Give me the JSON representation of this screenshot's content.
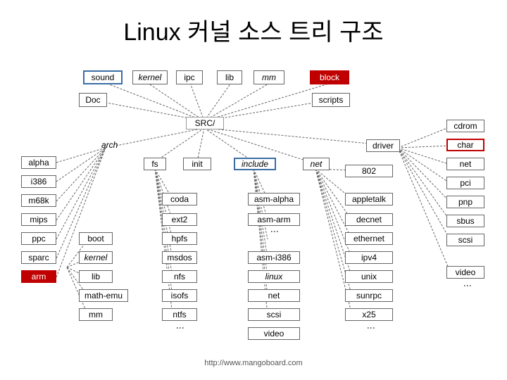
{
  "title": "Linux 커널 소스 트리 구조",
  "row1": {
    "sound": "sound",
    "kernel": "kernel",
    "ipc": "ipc",
    "lib": "lib",
    "mm": "mm",
    "block": "block"
  },
  "doc": "Doc",
  "scripts": "scripts",
  "src": "SRC/",
  "arch": "arch",
  "driver": "driver",
  "archlist": {
    "alpha": "alpha",
    "i386": "i386",
    "m68k": "m68k",
    "mips": "mips",
    "ppc": "ppc",
    "sparc": "sparc",
    "arm": "arm"
  },
  "sub": {
    "boot": "boot",
    "kernel": "kernel",
    "lib": "lib",
    "mathemu": "math-emu",
    "mm": "mm"
  },
  "fs": "fs",
  "init": "init",
  "fslist": {
    "coda": "coda",
    "ext2": "ext2",
    "hpfs": "hpfs",
    "msdos": "msdos",
    "nfs": "nfs",
    "isofs": "isofs",
    "ntfs": "ntfs"
  },
  "include": "include",
  "inclist": {
    "asmalpha": "asm-alpha",
    "asmarm": "asm-arm",
    "asmi386": "asm-i386",
    "linux": "linux",
    "net": "net",
    "scsi": "scsi",
    "video": "video"
  },
  "netlabel": "net",
  "netlist": {
    "n802": "802",
    "appletalk": "appletalk",
    "decnet": "decnet",
    "ethernet": "ethernet",
    "ipv4": "ipv4",
    "unix": "unix",
    "sunrpc": "sunrpc",
    "x25": "x25"
  },
  "right": {
    "cdrom": "cdrom",
    "char": "char",
    "net": "net",
    "pci": "pci",
    "pnp": "pnp",
    "sbus": "sbus",
    "scsi": "scsi",
    "video": "video"
  },
  "footer": "http://www.mangoboard.com"
}
